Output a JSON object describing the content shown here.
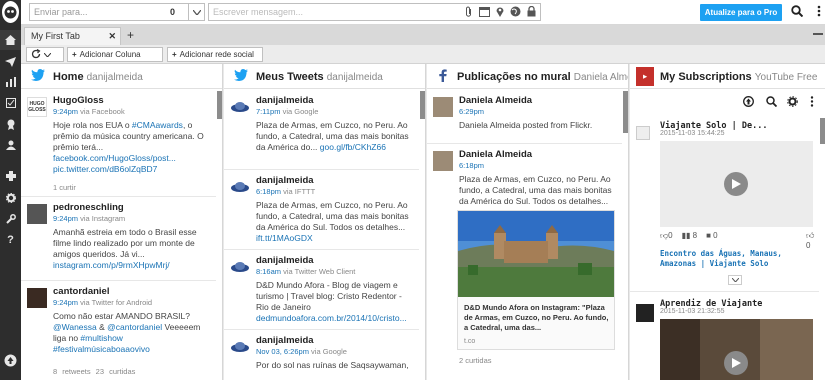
{
  "topbar": {
    "send_placeholder": "Enviar para...",
    "send_count": "0",
    "compose_placeholder": "Escrever mensagem...",
    "upgrade_label": "Atualize para o Pro"
  },
  "tabs": [
    {
      "label": "My First Tab"
    }
  ],
  "toolbar": {
    "add_column": "Adicionar Coluna",
    "add_network": "Adicionar rede social"
  },
  "columns": {
    "home": {
      "title": "Home",
      "account": "danijalmeida",
      "messages": [
        {
          "author": "HugoGloss",
          "time": "9:24pm",
          "via": "via Facebook",
          "body": "Hoje rola nos EUA o ",
          "tag": "#CMAawards",
          "body2": ", o prêmio da música country americana. O prêmio terá...",
          "link1": "facebook.com/HugoGloss/post...",
          "link2": "pic.twitter.com/dB6olZqBD7",
          "foot": "1 curtir"
        },
        {
          "author": "pedroneschling",
          "time": "9:24pm",
          "via": "via Instagram",
          "body": "Amanhã estreia em todo o Brasil esse filme lindo realizado por um monte de amigos queridos.",
          "body2": "Já vi... ",
          "link1": "instagram.com/p/9rmXHpwMrj/"
        },
        {
          "author": "cantordaniel",
          "time": "9:24pm",
          "via": "via Twitter for Android",
          "body": "Como não estar AMANDO BRASIL?",
          "m1": "@Wanessa",
          "amp": " & ",
          "m2": "@cantordaniel",
          "body2": " Veeeeem liga no ",
          "tag1": "#multishow",
          "tag2": "#festivalmúsicaboaaovivo",
          "foot": "8 retweets   23 curtidas"
        }
      ]
    },
    "mytweets": {
      "title": "Meus Tweets",
      "account": "danijalmeida",
      "messages": [
        {
          "author": "danijalmeida",
          "time": "7:11pm",
          "via": "via Google",
          "body": "Plaza de Armas, em Cuzco, no Peru. Ao fundo, a Catedral, uma das mais bonitas da América do... ",
          "link": "goo.gl/fb/CKhZ66"
        },
        {
          "author": "danijalmeida",
          "time": "6:18pm",
          "via": "via IFTTT",
          "body": "Plaza de Armas, em Cuzco, no Peru. Ao fundo, a Catedral, uma das mais bonitas da América do Sul. Todos os detalhes...",
          "link": "ift.tt/1MAoGDX"
        },
        {
          "author": "danijalmeida",
          "time": "8:16am",
          "via": "via Twitter Web Client",
          "body": "D&D Mundo Afora - Blog de viagem e turismo | Travel blog: Cristo Redentor - Rio de Janeiro",
          "link": "dedmundoafora.com.br/2014/10/cristo..."
        },
        {
          "author": "danijalmeida",
          "time": "Nov 03, 6:26pm",
          "via": "via Google",
          "body": "Por do sol nas ruínas de Saqsaywaman,"
        }
      ]
    },
    "wall": {
      "title": "Publicações no mural",
      "account": "Daniela Almei...",
      "messages": [
        {
          "author": "Daniela Almeida",
          "time": "6:29pm",
          "body": "Daniela Almeida posted from Flickr."
        },
        {
          "author": "Daniela Almeida",
          "time": "6:18pm",
          "body": "Plaza de Armas, em Cuzco, no Peru. Ao fundo, a Catedral, uma das mais bonitas da América do Sul. Todos os detalhes...",
          "card_title": "D&D Mundo Afora on Instagram: \"Plaza de Armas, em Cuzco, no Peru. Ao fundo, a Catedral, uma das...",
          "card_domain": "t.co",
          "foot": "2 curtidas"
        }
      ]
    },
    "youtube": {
      "title": "My Subscriptions",
      "account": "YouTube Free",
      "videos": [
        {
          "channel": "Viajante Solo | De...",
          "date": "2015-11-03 15:44:25",
          "dislikes": "0",
          "views": "8",
          "comments": "0",
          "likes": "0",
          "title": "Encontro das Águas, Manaus, Amazonas | Viajante Solo"
        },
        {
          "channel": "Aprendiz de Viajante",
          "date": "2015-11-03 21:32:55"
        }
      ]
    }
  }
}
